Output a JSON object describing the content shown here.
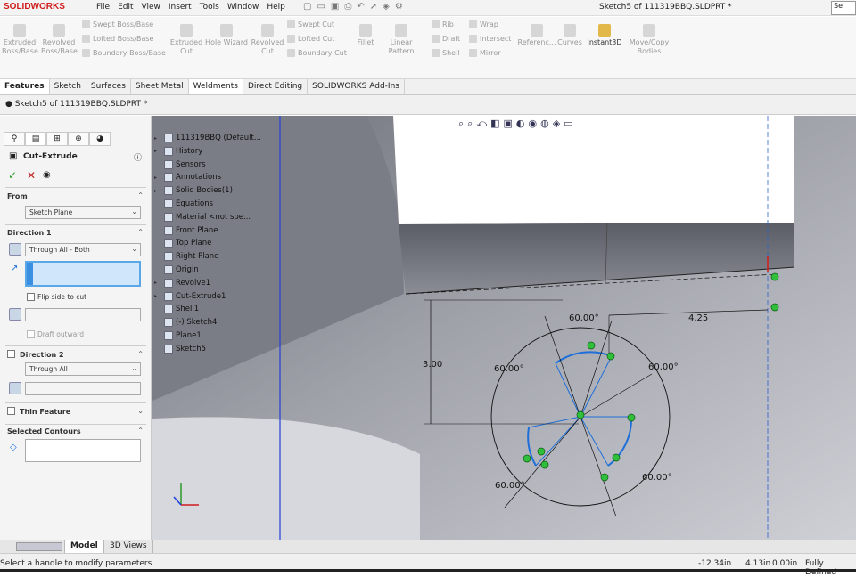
{
  "app": {
    "logo": "SOLIDWORKS",
    "doc_title": "Sketch5 of 111319BBQ.SLDPRT *",
    "search": "Se"
  },
  "menus": [
    "File",
    "Edit",
    "View",
    "Insert",
    "Tools",
    "Window",
    "Help"
  ],
  "commands": {
    "extruded_boss": "Extruded Boss/Base",
    "revolved_boss": "Revolved Boss/Base",
    "swept_boss": "Swept Boss/Base",
    "lofted_boss": "Lofted Boss/Base",
    "boundary_boss": "Boundary Boss/Base",
    "extruded_cut": "Extruded Cut",
    "hole_wizard": "Hole Wizard",
    "revolved_cut": "Revolved Cut",
    "swept_cut": "Swept Cut",
    "lofted_cut": "Lofted Cut",
    "boundary_cut": "Boundary Cut",
    "fillet": "Fillet",
    "linear_pattern": "Linear Pattern",
    "rib": "Rib",
    "draft": "Draft",
    "shell": "Shell",
    "wrap": "Wrap",
    "intersect": "Intersect",
    "mirror": "Mirror",
    "reference": "Referenc...",
    "curves": "Curves",
    "instant3d": "Instant3D",
    "move_copy": "Move/Copy Bodies"
  },
  "tabs": [
    "Features",
    "Sketch",
    "Surfaces",
    "Sheet Metal",
    "Weldments",
    "Direct Editing",
    "SOLIDWORKS Add-Ins"
  ],
  "doc_tab": "Sketch5 of 111319BBQ.SLDPRT *",
  "property_manager": {
    "title": "Cut-Extrude",
    "from_label": "From",
    "from_value": "Sketch Plane",
    "direction1_label": "Direction 1",
    "direction1_value": "Through All - Both",
    "flip_side": "Flip side to cut",
    "draft_outward": "Draft outward",
    "direction2_label": "Direction 2",
    "direction2_value": "Through All",
    "thin_feature": "Thin Feature",
    "selected_contours": "Selected Contours"
  },
  "tree": [
    {
      "label": "111319BBQ  (Default...",
      "exp": true
    },
    {
      "label": "History",
      "exp": true
    },
    {
      "label": "Sensors",
      "exp": false
    },
    {
      "label": "Annotations",
      "exp": true
    },
    {
      "label": "Solid Bodies(1)",
      "exp": true
    },
    {
      "label": "Equations",
      "exp": false
    },
    {
      "label": "Material <not spe...",
      "exp": false
    },
    {
      "label": "Front Plane",
      "exp": false
    },
    {
      "label": "Top Plane",
      "exp": false
    },
    {
      "label": "Right Plane",
      "exp": false
    },
    {
      "label": "Origin",
      "exp": false
    },
    {
      "label": "Revolve1",
      "exp": true
    },
    {
      "label": "Cut-Extrude1",
      "exp": true
    },
    {
      "label": "Shell1",
      "exp": false
    },
    {
      "label": "(-) Sketch4",
      "exp": false
    },
    {
      "label": "Plane1",
      "exp": false
    },
    {
      "label": "Sketch5",
      "exp": false
    }
  ],
  "dimensions": {
    "angle_top": "60.00°",
    "angle_left": "60.00°",
    "angle_right": "60.00°",
    "angle_bottom_left": "60.00°",
    "angle_bottom_right": "60.00°",
    "vertical": "3.00",
    "horizontal": "4.25"
  },
  "bottom_tabs": [
    "Model",
    "3D Views"
  ],
  "status": {
    "message": "Select a handle to modify parameters",
    "x": "-12.34in",
    "y": "4.13in",
    "z": "0.00in",
    "state": "Fully Defined"
  },
  "colors": {
    "accent": "#1e6fd9",
    "logo": "#d01c1c",
    "relation": "#2fbf3a"
  }
}
